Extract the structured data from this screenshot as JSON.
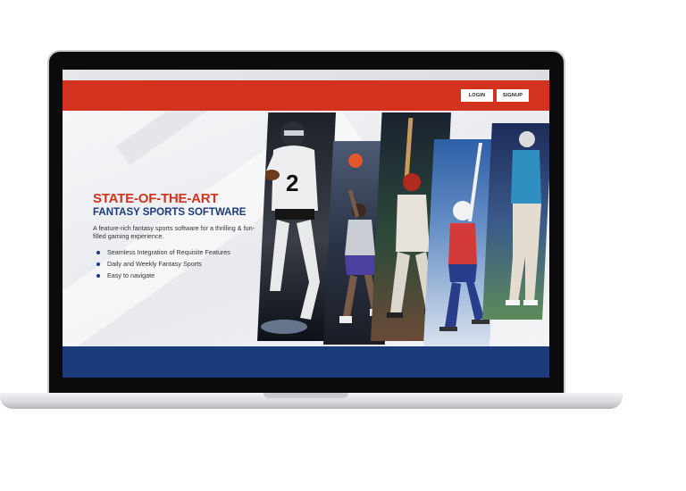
{
  "nav": {
    "login_label": "LOGIN",
    "signup_label": "SIGNUP"
  },
  "hero": {
    "headline": "STATE-OF-THE-ART",
    "subheadline": "FANTASY SPORTS SOFTWARE",
    "description": "A feature-rich fantasy sports software for a thrilling & fun-filled gaming experience.",
    "features": [
      "Seamless Integration of Requisite Features",
      "Daily and Weekly Fantasy Sports",
      "Easy to navigate"
    ]
  },
  "panels": [
    {
      "sport": "american-football",
      "icon": "football-player-image"
    },
    {
      "sport": "basketball",
      "icon": "basketball-player-image"
    },
    {
      "sport": "baseball",
      "icon": "baseball-player-image"
    },
    {
      "sport": "ice-hockey",
      "icon": "hockey-player-image"
    },
    {
      "sport": "golf",
      "icon": "golf-player-image"
    }
  ],
  "colors": {
    "brand_red": "#d3321f",
    "brand_blue": "#1c3b7a",
    "bezel": "#0b0b0d"
  }
}
